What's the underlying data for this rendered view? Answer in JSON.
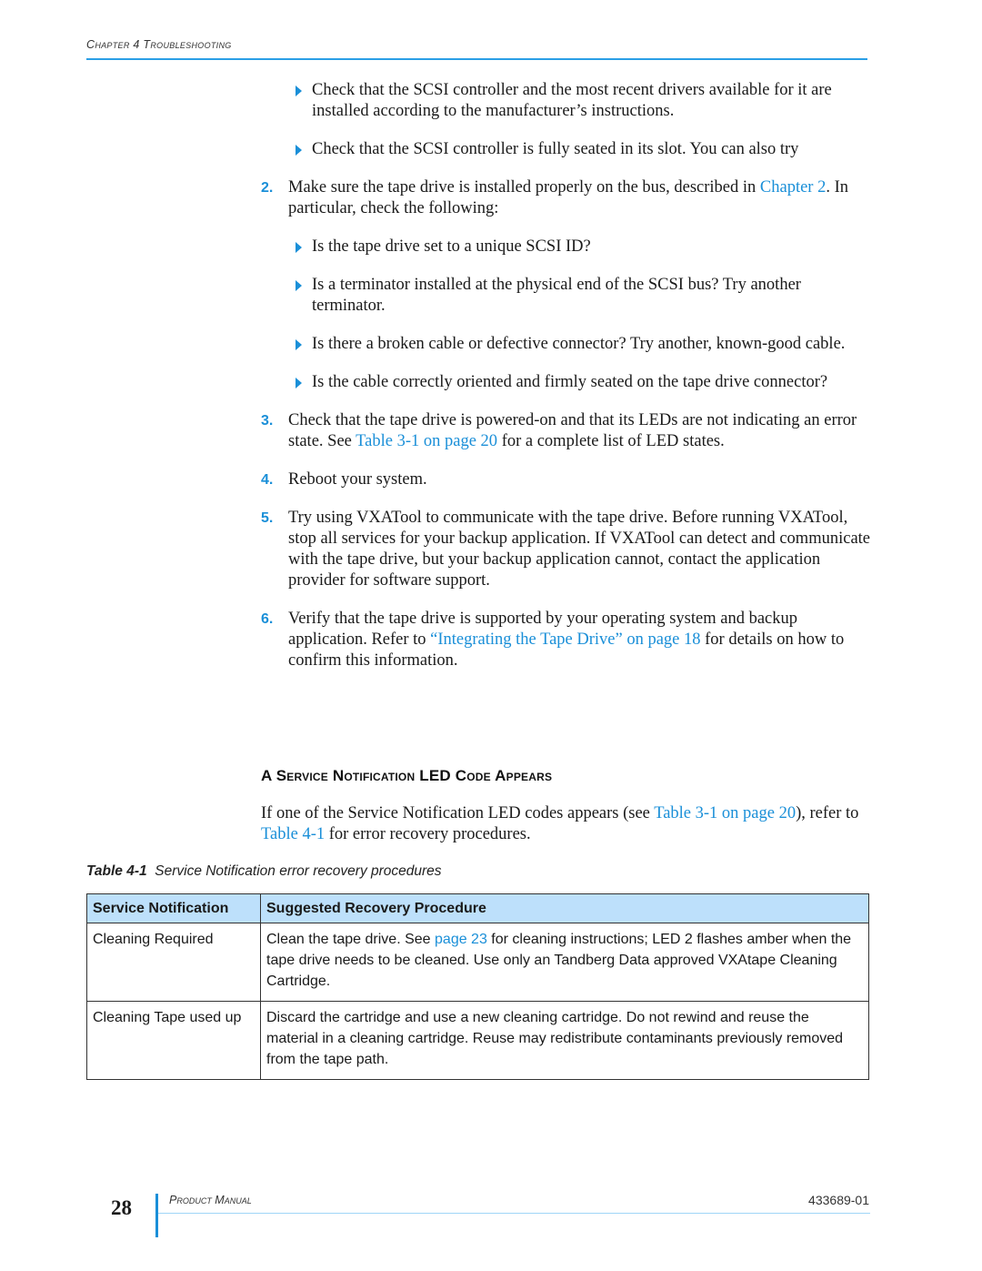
{
  "header": {
    "chapter": "Chapter 4 Troubleshooting"
  },
  "steps": {
    "bullets_a": [
      "Check that the SCSI controller and the most recent drivers available for it are installed according to the manufacturer’s instructions.",
      "Check that the SCSI controller is fully seated in its slot. You can also try"
    ],
    "step2": {
      "number": "2.",
      "text_before": "Make sure the tape drive is installed properly on the bus, described in ",
      "link": "Chapter 2",
      "text_after": ". In particular, check the following:",
      "bullets": [
        "Is the tape drive set to a unique SCSI ID?",
        "Is a terminator installed at the physical end of the SCSI bus? Try another terminator.",
        "Is there a broken cable or defective connector? Try another, known-good cable.",
        "Is the cable correctly oriented and firmly seated on the tape drive connector?"
      ]
    },
    "step3": {
      "number": "3.",
      "text_before": "Check that the tape drive is powered-on and that its LEDs are not indicating an error state. See ",
      "link": "Table 3-1 on page 20",
      "text_after": " for a complete list of LED states."
    },
    "step4": {
      "number": "4.",
      "text": "Reboot your system."
    },
    "step5": {
      "number": "5.",
      "text": "Try using VXATool to communicate with the tape drive. Before running VXATool, stop all services for your backup application. If VXATool can detect and communicate with the tape drive, but your backup application cannot, contact the application provider for software support."
    },
    "step6": {
      "number": "6.",
      "text_before": "Verify that the tape drive is supported by your operating system and backup application. Refer to ",
      "link": "“Integrating the Tape Drive” on page 18",
      "text_after": " for details on how to confirm this information."
    }
  },
  "section": {
    "title": "A Service Notification LED Code Appears",
    "intro_before": "If one of the Service Notification LED codes appears (see ",
    "intro_link1": "Table 3-1 on page 20",
    "intro_mid": "), refer to ",
    "intro_link2": "Table 4-1",
    "intro_after": " for error recovery procedures."
  },
  "table": {
    "caption_label": "Table 4-1",
    "caption_text": "Service Notification error recovery procedures",
    "headers": [
      "Service Notification",
      "Suggested Recovery Procedure"
    ],
    "rows": [
      {
        "notification": "Cleaning Required",
        "proc_before": "Clean the tape drive. See ",
        "proc_link": "page 23",
        "proc_after": " for cleaning instructions; LED 2 flashes amber when the tape drive needs to be cleaned. Use only an Tandberg Data approved VXAtape Cleaning Cartridge."
      },
      {
        "notification": "Cleaning Tape used up",
        "proc_before": "Discard the cartridge and use a new cleaning cartridge. Do not rewind and reuse the material in a cleaning cartridge. Reuse may redistribute contaminants previously removed from the tape path.",
        "proc_link": "",
        "proc_after": ""
      }
    ]
  },
  "footer": {
    "page_number": "28",
    "title": "Product Manual",
    "doc_number": "433689-01"
  },
  "colors": {
    "accent": "#1a8fd8",
    "table_header": "#bde0fb"
  }
}
